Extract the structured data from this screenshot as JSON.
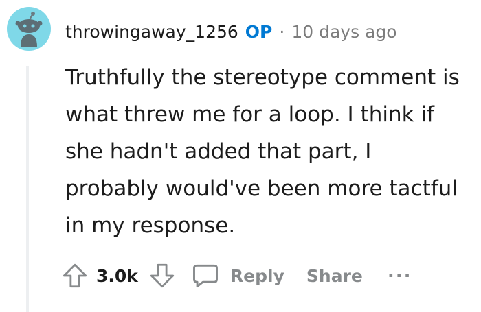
{
  "comment": {
    "username": "throwingaway_1256",
    "op_badge": "OP",
    "separator": "·",
    "timestamp": "10 days ago",
    "body": "Truthfully the stereotype comment is what threw me for a loop. I think if she hadn't added that part, I probably would've been more tactful in my response."
  },
  "actions": {
    "score": "3.0k",
    "reply_label": "Reply",
    "share_label": "Share",
    "more_label": "..."
  },
  "icons": {
    "avatar": "snoo-avatar-icon",
    "upvote": "upvote-arrow-icon",
    "downvote": "downvote-arrow-icon",
    "reply": "speech-bubble-icon"
  },
  "colors": {
    "avatar_bg": "#7fd8e8",
    "op_badge": "#0079d3",
    "muted": "#7c7c7c",
    "action": "#878a8c",
    "thread_line": "#edeff1"
  }
}
